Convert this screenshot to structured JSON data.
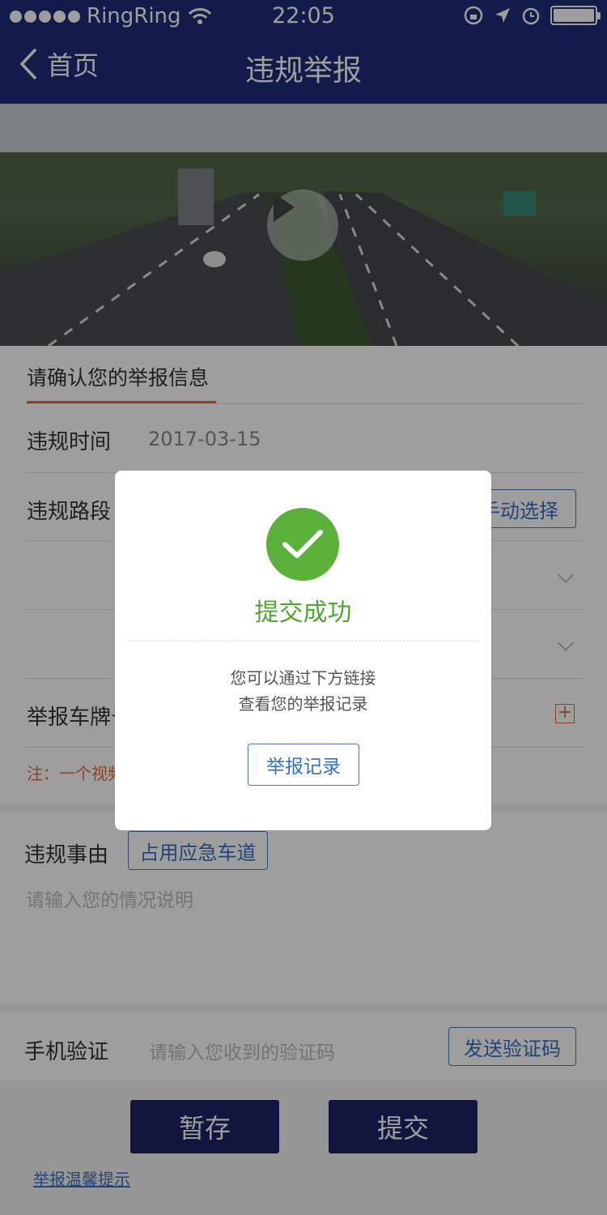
{
  "status_bar": {
    "carrier": "RingRing",
    "time": "22:05"
  },
  "nav": {
    "back_label": "首页",
    "title": "违规举报"
  },
  "form": {
    "section_title": "请确认您的举报信息",
    "time_label": "违规时间",
    "time_value": "2017-03-15",
    "road_label": "违规路段",
    "manual_select_label": "手动选择",
    "plate_label": "举报车牌号",
    "note": "注：一个视频"
  },
  "reason": {
    "label": "违规事由",
    "tag": "占用应急车道",
    "placeholder": "请输入您的情况说明"
  },
  "verify": {
    "label": "手机验证",
    "placeholder": "请输入您收到的验证码",
    "send_button": "发送验证码"
  },
  "actions": {
    "save_label": "暂存",
    "submit_label": "提交",
    "tip_link": "举报温馨提示"
  },
  "dialog": {
    "title": "提交成功",
    "line1": "您可以通过下方链接",
    "line2": "查看您的举报记录",
    "record_button": "举报记录"
  },
  "colors": {
    "nav_bg": "#1e2d78",
    "success": "#5bb03a",
    "accent_orange": "#e06a3b",
    "link_blue": "#3b6fbf",
    "button_dark": "#1e2466"
  }
}
